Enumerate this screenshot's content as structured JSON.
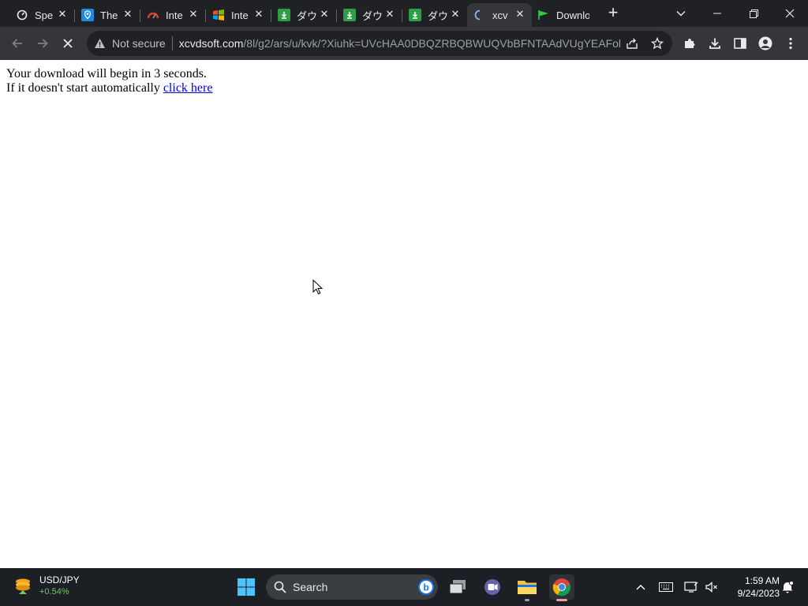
{
  "browser": {
    "tabs": [
      {
        "title": "Spe",
        "favicon": "speedtest-icon",
        "color": "#e8eaed"
      },
      {
        "title": "The",
        "favicon": "shield-pin-icon",
        "color": "#1e88e5"
      },
      {
        "title": "Inte",
        "favicon": "gauge-icon",
        "color": "#e53935"
      },
      {
        "title": "Inte",
        "favicon": "windows-logo-icon",
        "color": "#f4b400"
      },
      {
        "title": "ダウ",
        "favicon": "download-icon",
        "color": "#2e9e44"
      },
      {
        "title": "ダウ",
        "favicon": "download-icon",
        "color": "#2e9e44"
      },
      {
        "title": "ダウ",
        "favicon": "download-icon",
        "color": "#2e9e44"
      },
      {
        "title": "xcv",
        "favicon": "loading-spinner-icon",
        "color": "#8ab4f8",
        "active": true
      },
      {
        "title": "Downlo",
        "favicon": "flag-icon",
        "color": "#2ecc40"
      }
    ],
    "address_bar": {
      "security_label": "Not secure",
      "host": "xcvdsoft.com",
      "path": "/8l/g2/ars/u/kvk/?Xiuhk=UVcHAA0DBQZRBQBWUQVbBFNTAAdVUgYEAFol..."
    }
  },
  "page": {
    "line1": "Your download will begin in 3 seconds.",
    "line2_prefix": "If it doesn't start automatically",
    "link_text": "click here"
  },
  "taskbar": {
    "ticker_symbol": "USD/JPY",
    "ticker_change": "+0.54%",
    "search_label": "Search",
    "time": "1:59 AM",
    "date": "9/24/2023"
  }
}
